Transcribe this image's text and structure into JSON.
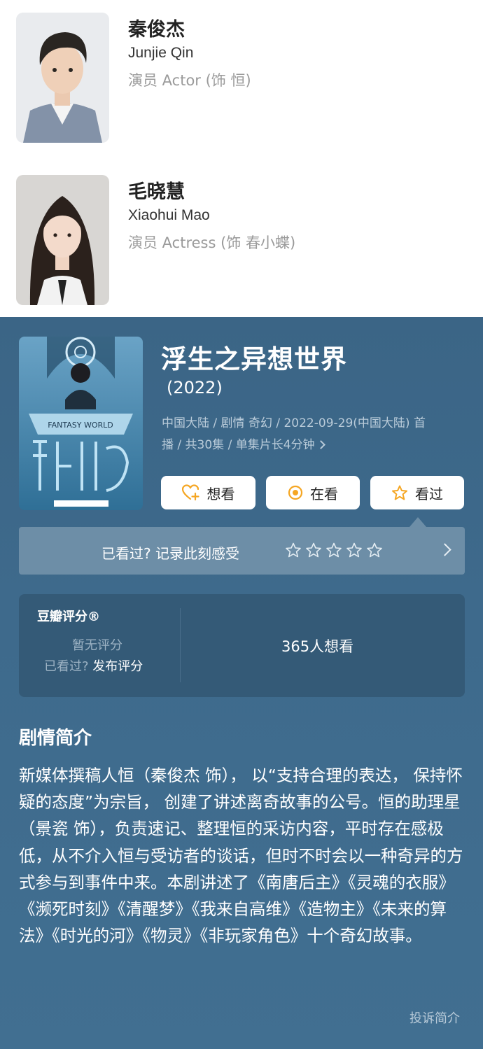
{
  "cast": [
    {
      "name": "秦俊杰",
      "name_en": "Junjie Qin",
      "role": "演员 Actor (饰 恒)"
    },
    {
      "name": "毛晓慧",
      "name_en": "Xiaohui Mao",
      "role": "演员 Actress (饰 春小蝶)"
    }
  ],
  "movie": {
    "title": "浮生之异想世界",
    "year": "(2022)",
    "meta_line1": "中国大陆 / 剧情 奇幻 / 2022-09-29(中国大陆) 首",
    "meta_line2": "播 / 共30集 / 单集片长4分钟",
    "poster_text": "FANTASY WORLD"
  },
  "actions": {
    "want_label": "想看",
    "watching_label": "在看",
    "watched_label": "看过"
  },
  "rate_bar": {
    "prompt": "已看过? 记录此刻感受",
    "stars_max": 5
  },
  "score": {
    "title": "豆瓣评分®",
    "no_score": "暂无评分",
    "seen_prefix": "已看过? ",
    "publish": "发布评分",
    "want_count": "365人想看"
  },
  "synopsis": {
    "title": "剧情简介",
    "body": "新媒体撰稿人恒（秦俊杰 饰）， 以“支持合理的表达， 保持怀疑的态度”为宗旨， 创建了讲述离奇故事的公号。恒的助理星（景瓷 饰），负责速记、整理恒的采访内容，平时存在感极低，从不介入恒与受访者的谈话，但时不时会以一种奇异的方式参与到事件中来。本剧讲述了《南唐后主》《灵魂的衣服》《濒死时刻》《清醒梦》《我来自高维》《造物主》《未来的算法》《时光的河》《物灵》《非玩家角色》十个奇幻故事。",
    "report": "投诉简介"
  },
  "colors": {
    "panel_bg": "#3e6a8c",
    "card_bg": "#345a77",
    "bar_bg": "#6d8ea7",
    "accent_orange": "#f5a623"
  }
}
